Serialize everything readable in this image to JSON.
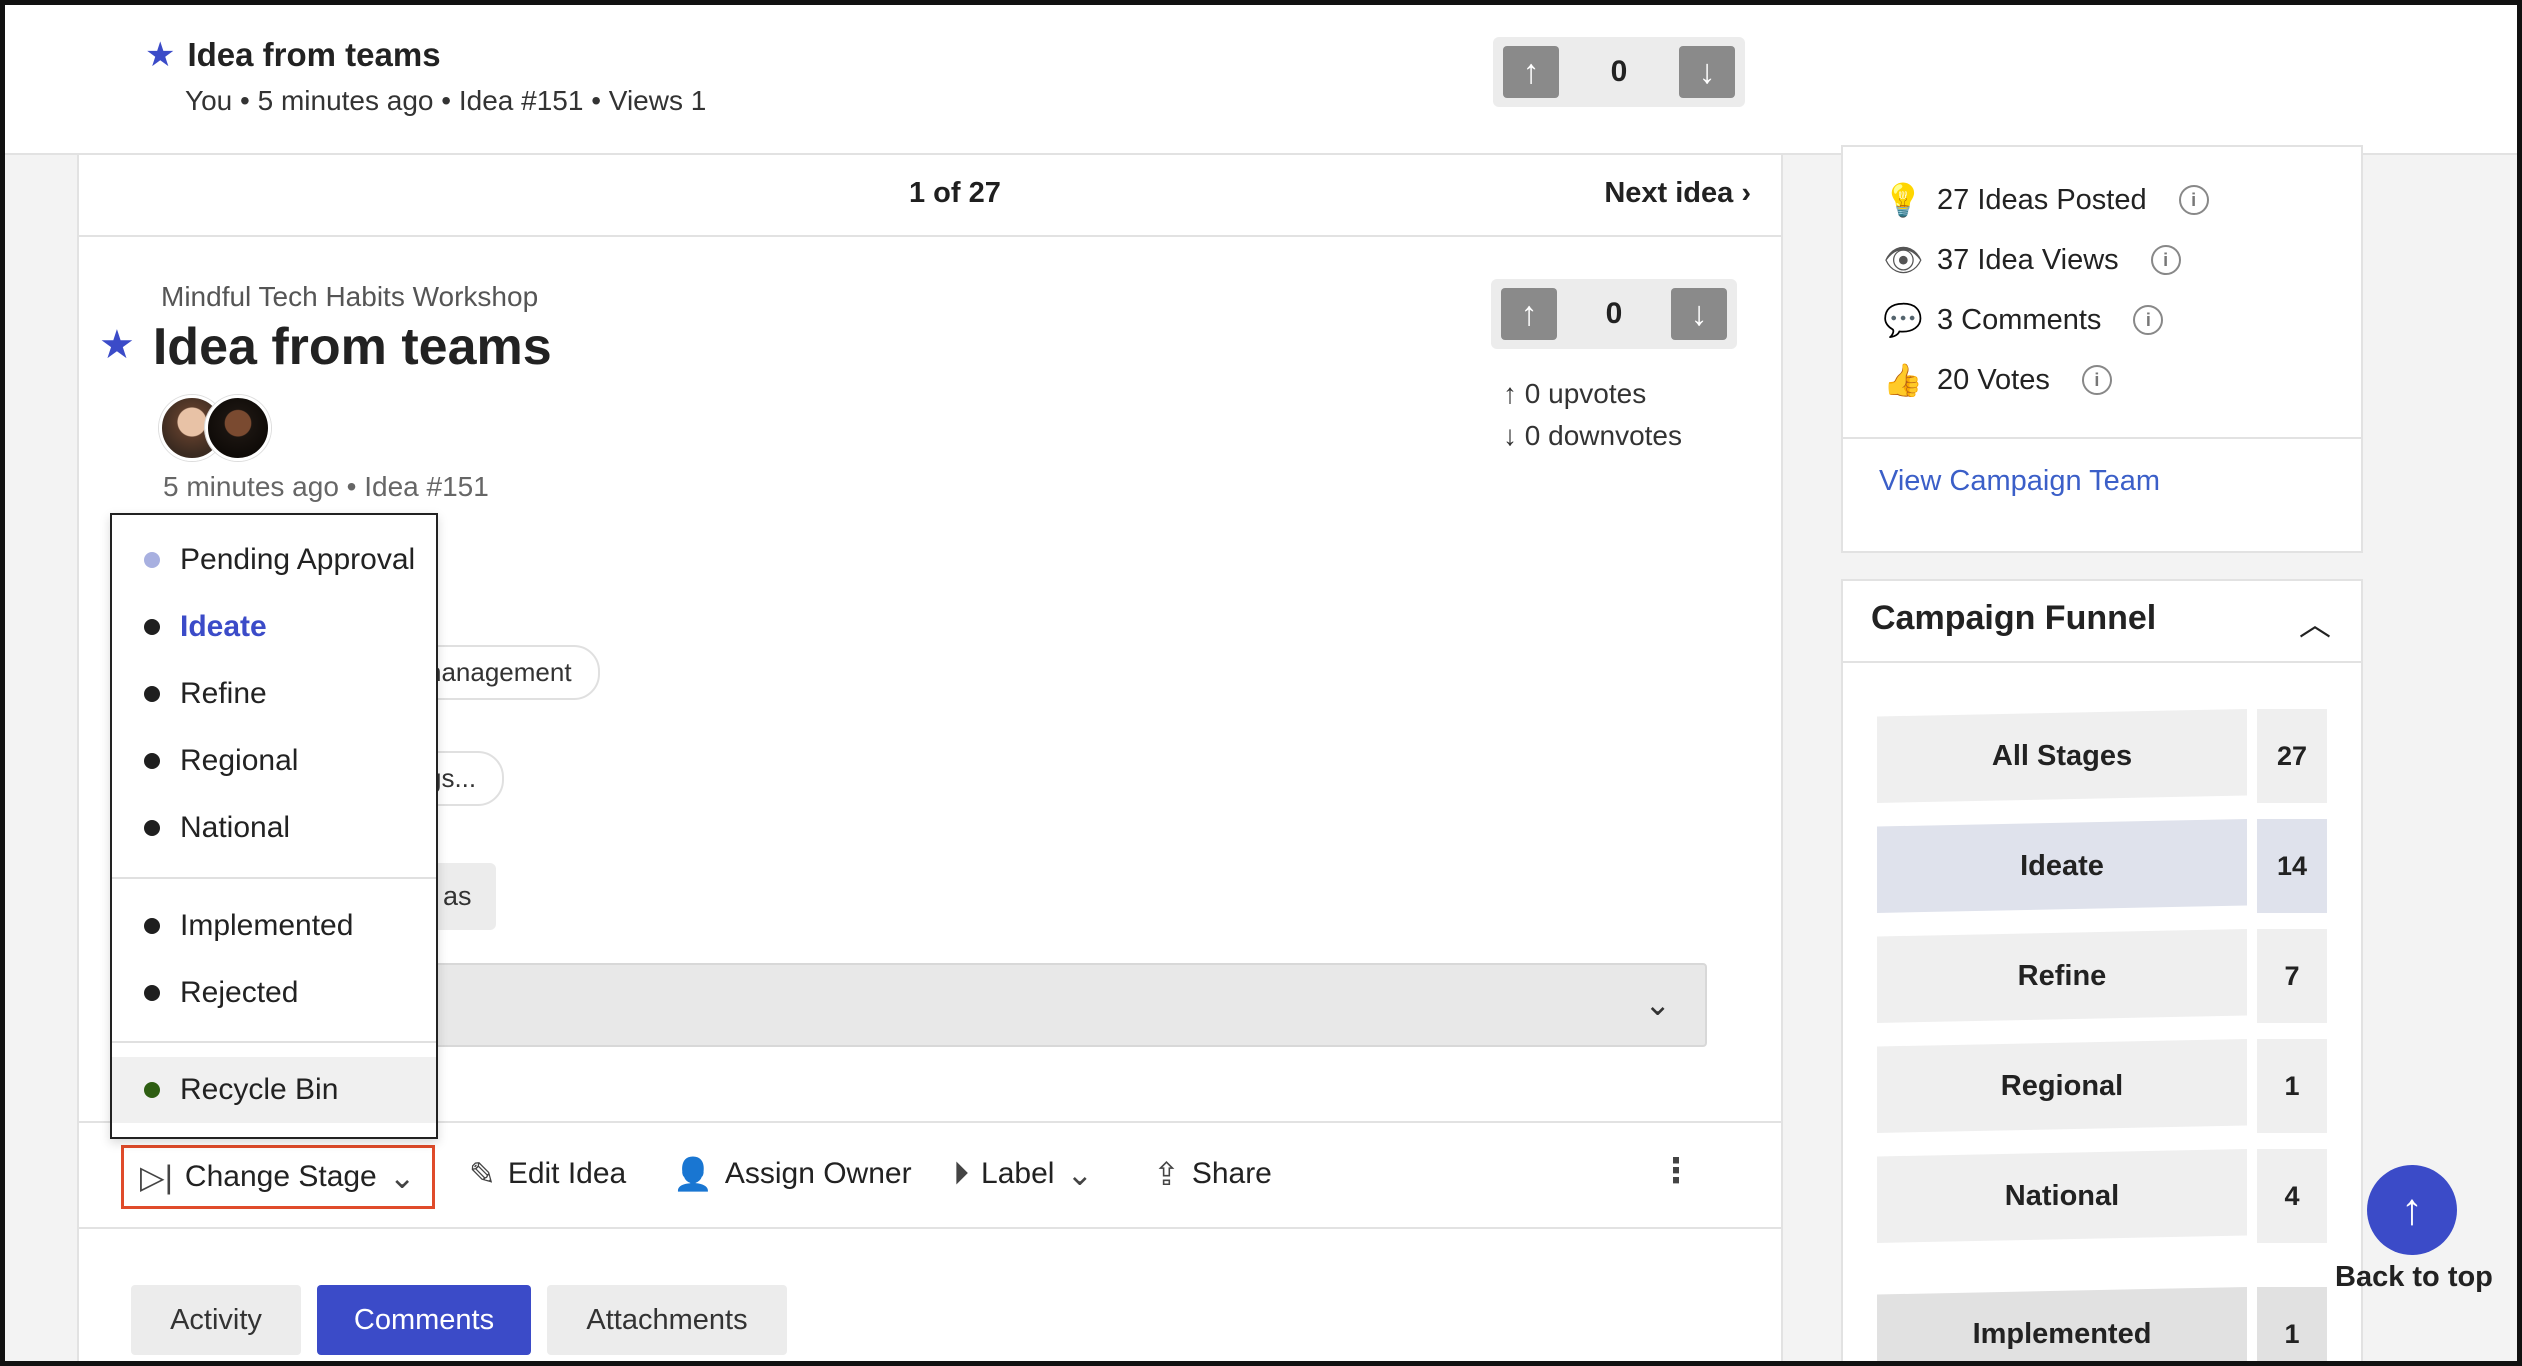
{
  "header": {
    "title": "Idea from teams",
    "meta": "You • 5 minutes ago • Idea #151 • Views 1",
    "vote_count": "0"
  },
  "pager": {
    "position": "1 of 27",
    "next_label": "Next idea"
  },
  "idea": {
    "campaign": "Mindful Tech Habits Workshop",
    "title": "Idea from teams",
    "meta": "5 minutes ago  • Idea #151",
    "vote_count": "0",
    "upvotes": "0 upvotes",
    "downvotes": "0 downvotes",
    "chip1_fragment": "nanagement",
    "chip2_fragment": "gs...",
    "chip3_fragment": "as"
  },
  "stage_menu": {
    "items": [
      {
        "label": "Pending Approval",
        "color": "#a8b0e0"
      },
      {
        "label": "Ideate",
        "color": "#1f1f1f",
        "selected": true
      },
      {
        "label": "Refine",
        "color": "#1f1f1f"
      },
      {
        "label": "Regional",
        "color": "#1f1f1f"
      },
      {
        "label": "National",
        "color": "#1f1f1f"
      },
      {
        "label": "Implemented",
        "color": "#1f1f1f"
      },
      {
        "label": "Rejected",
        "color": "#1f1f1f"
      },
      {
        "label": "Recycle Bin",
        "color": "#2e5e12"
      }
    ]
  },
  "actions": {
    "change_stage": "Change Stage",
    "edit_idea": "Edit Idea",
    "assign_owner": "Assign Owner",
    "label": "Label",
    "share": "Share"
  },
  "tabs": [
    "Activity",
    "Comments",
    "Attachments"
  ],
  "sidebar": {
    "stats": [
      "27 Ideas Posted",
      "37 Idea Views",
      "3 Comments",
      "20 Votes"
    ],
    "team_link": "View Campaign Team",
    "funnel_title": "Campaign Funnel",
    "funnel": [
      {
        "label": "All Stages",
        "count": "27"
      },
      {
        "label": "Ideate",
        "count": "14"
      },
      {
        "label": "Refine",
        "count": "7"
      },
      {
        "label": "Regional",
        "count": "1"
      },
      {
        "label": "National",
        "count": "4"
      },
      {
        "label": "Implemented",
        "count": "1"
      }
    ]
  },
  "back_to_top": "Back to top",
  "colors": {
    "accent": "#3b4bc8",
    "highlight_border": "#e04b2a"
  }
}
